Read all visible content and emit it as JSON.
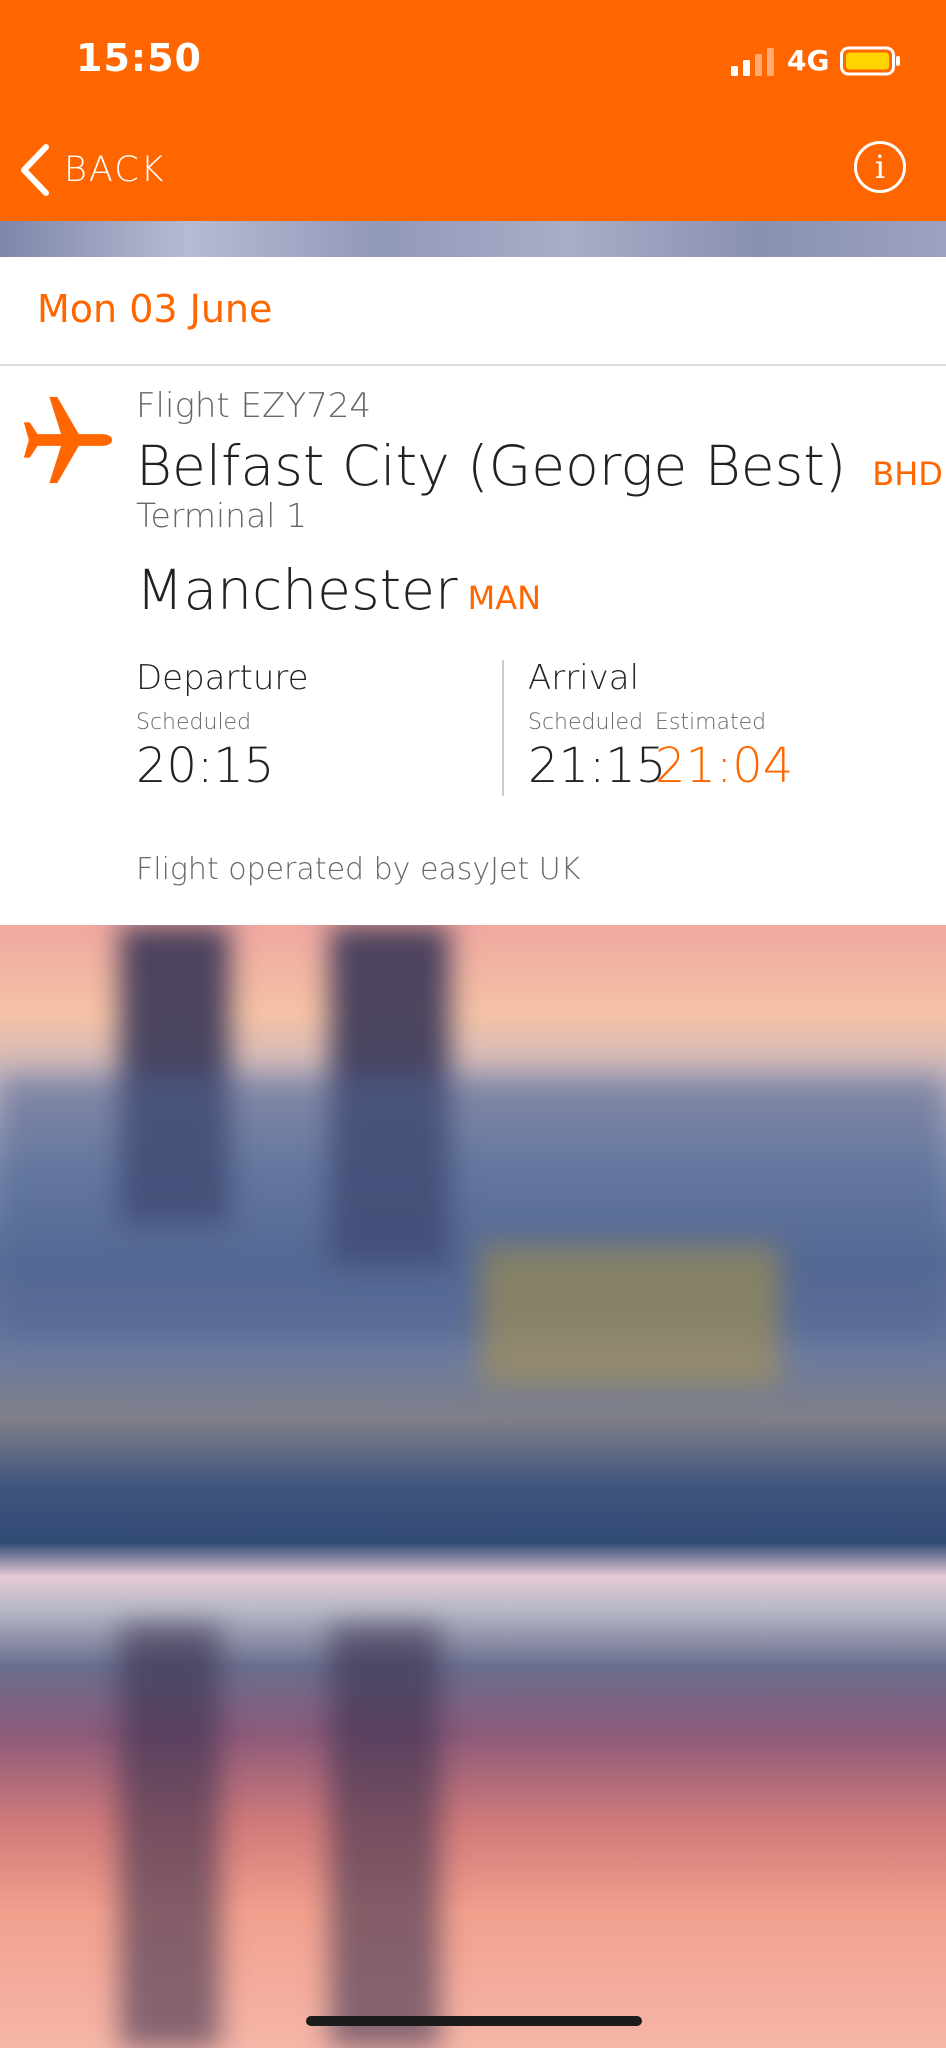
{
  "status_bar": {
    "time": "15:50",
    "network": "4G"
  },
  "nav": {
    "back_label": "BACK",
    "info_icon": "i"
  },
  "date": "Mon 03 June",
  "flight": {
    "number": "Flight EZY724",
    "origin_name": "Belfast City (George Best)",
    "origin_code": "BHD",
    "terminal": "Terminal 1",
    "destination_name": "Manchester",
    "destination_code": "MAN",
    "departure": {
      "heading": "Departure",
      "scheduled_label": "Scheduled",
      "scheduled_time": "20:15"
    },
    "arrival": {
      "heading": "Arrival",
      "scheduled_label": "Scheduled",
      "scheduled_time": "21:15",
      "estimated_label": "Estimated",
      "estimated_time": "21:04"
    },
    "operated_by": "Flight operated by easyJet UK"
  },
  "colors": {
    "accent": "#ff6600",
    "text_dark": "#222222",
    "text_muted": "#666666"
  }
}
